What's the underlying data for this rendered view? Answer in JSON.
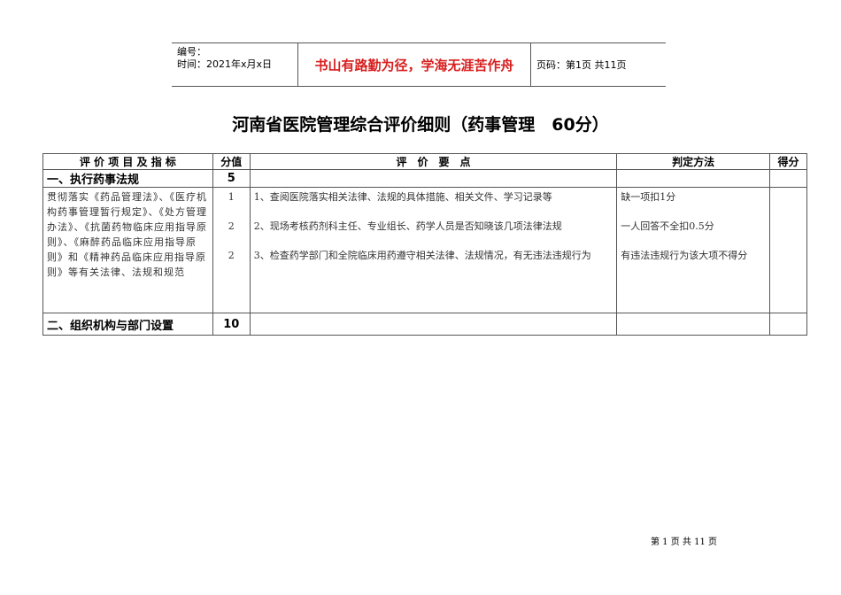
{
  "header": {
    "number_label": "编号：",
    "time_label": "时间：2021年x月x日",
    "motto": "书山有路勤为径，学海无涯苦作舟",
    "page_label": "页码：第1页  共11页"
  },
  "title": "河南省医院管理综合评价细则（药事管理　60分）",
  "table": {
    "columns": [
      "评 价 项 目 及 指 标",
      "分值",
      "评　价　要　点",
      "判定方法",
      "得分"
    ],
    "sections": [
      {
        "name": "一、执行药事法规",
        "score": "5"
      },
      {
        "name": "二、组织机构与部门设置",
        "score": "10"
      }
    ],
    "item": {
      "indicator": "贯彻落实《药品管理法》、《医疗机构药事管理暂行规定》、《处方管理办法》、《抗菌药物临床应用指导原则》、《麻醉药品临床应用指导原则》和《精神药品临床应用指导原则》等有关法律、法规和规范",
      "scores": [
        "1",
        "2",
        "2"
      ],
      "points": [
        "1、查阅医院落实相关法律、法规的具体措施、相关文件、学习记录等",
        "2、现场考核药剂科主任、专业组长、药学人员是否知晓该几项法律法规",
        "3、检查药学部门和全院临床用药遵守相关法律、法规情况，有无违法违规行为"
      ],
      "methods": [
        "缺一项扣1分",
        "一人回答不全扣0.5分",
        "有违法违规行为该大项不得分"
      ]
    }
  },
  "footer": "第 1 页 共 11 页"
}
